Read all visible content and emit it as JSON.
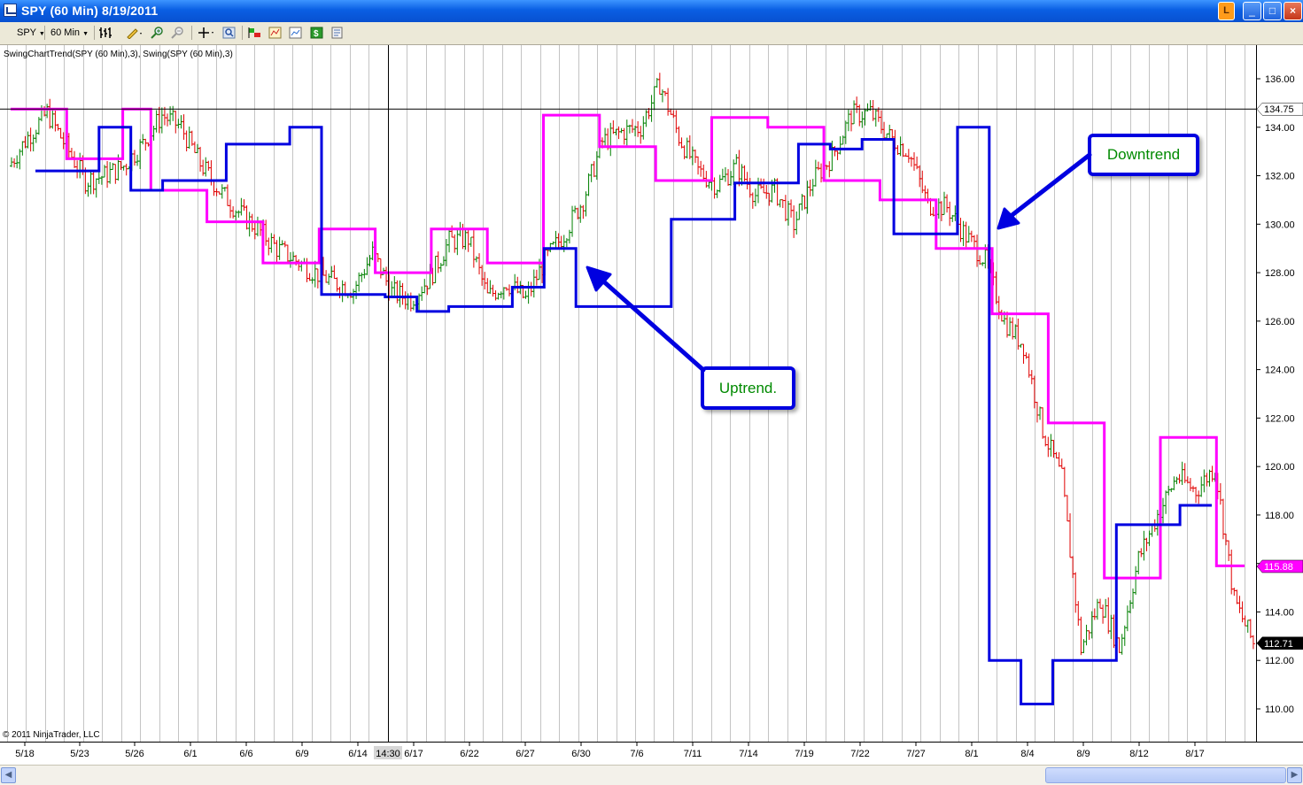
{
  "window": {
    "title": "SPY (60 Min)  8/19/2011",
    "buttons": [
      "L",
      "_",
      "□",
      "×"
    ]
  },
  "toolbar": {
    "instrument": "SPY",
    "interval": "60 Min",
    "icons": [
      "bar-type-icon",
      "drawing-pencil-icon",
      "zoom-in-icon",
      "zoom-out-icon",
      "crosshair-icon",
      "zoom-icon",
      "order-entry-icon",
      "strategies-icon",
      "chart-trader-icon",
      "dollar-icon",
      "properties-icon"
    ]
  },
  "chart": {
    "indicator_label": "SwingChartTrend(SPY (60 Min),3), Swing(SPY (60 Min),3)",
    "copyright": "© 2011 NinjaTrader, LLC",
    "price_ticks": [
      "136.00",
      "134.00",
      "132.00",
      "130.00",
      "128.00",
      "126.00",
      "124.00",
      "122.00",
      "120.00",
      "118.00",
      "116.00",
      "114.00",
      "112.00",
      "110.00"
    ],
    "date_ticks": [
      "5/18",
      "5/23",
      "5/26",
      "6/1",
      "6/6",
      "6/9",
      "6/14",
      "6/17",
      "6/22",
      "6/27",
      "6/30",
      "7/6",
      "7/11",
      "7/14",
      "7/19",
      "7/22",
      "7/27",
      "8/1",
      "8/4",
      "8/9",
      "8/12",
      "8/17"
    ],
    "crosshair_time": "14:30",
    "crosshair_price": "134.75",
    "magenta_price_label": "115.88",
    "last_price_label": "112.71",
    "colors": {
      "up_bar": "#008000",
      "down_bar": "#e00000",
      "downtrend_line": "#ff00ff",
      "uptrend_line": "#0000e0",
      "callout_border": "#0000e0",
      "callout_text": "#008a00"
    }
  },
  "annotations": {
    "downtrend": "Downtrend",
    "uptrend": "Uptrend."
  },
  "chart_data": {
    "type": "candlestick",
    "title": "SPY (60 Min)",
    "ylim": [
      109.0,
      137.0
    ],
    "x_tick_labels": [
      "5/18",
      "5/23",
      "5/26",
      "6/1",
      "6/6",
      "6/9",
      "6/14",
      "6/17",
      "6/22",
      "6/27",
      "6/30",
      "7/6",
      "7/11",
      "7/14",
      "7/19",
      "7/22",
      "7/27",
      "8/1",
      "8/4",
      "8/9",
      "8/12",
      "8/17"
    ],
    "price_path": [
      {
        "date": "5/18",
        "price": 132.4
      },
      {
        "date": "5/19",
        "price": 133.6
      },
      {
        "date": "5/20",
        "price": 134.6
      },
      {
        "date": "5/23",
        "price": 133.2
      },
      {
        "date": "5/24",
        "price": 131.8
      },
      {
        "date": "5/25",
        "price": 132.0
      },
      {
        "date": "5/26",
        "price": 132.4
      },
      {
        "date": "5/27",
        "price": 133.3
      },
      {
        "date": "5/31",
        "price": 134.5
      },
      {
        "date": "6/1",
        "price": 134.0
      },
      {
        "date": "6/2",
        "price": 132.5
      },
      {
        "date": "6/3",
        "price": 131.4
      },
      {
        "date": "6/6",
        "price": 130.5
      },
      {
        "date": "6/7",
        "price": 129.8
      },
      {
        "date": "6/8",
        "price": 129.0
      },
      {
        "date": "6/9",
        "price": 128.5
      },
      {
        "date": "6/10",
        "price": 128.0
      },
      {
        "date": "6/13",
        "price": 127.6
      },
      {
        "date": "6/14",
        "price": 127.3
      },
      {
        "date": "6/15",
        "price": 128.8
      },
      {
        "date": "6/16",
        "price": 127.2
      },
      {
        "date": "6/17",
        "price": 126.9
      },
      {
        "date": "6/20",
        "price": 127.8
      },
      {
        "date": "6/21",
        "price": 129.3
      },
      {
        "date": "6/22",
        "price": 129.4
      },
      {
        "date": "6/23",
        "price": 127.0
      },
      {
        "date": "6/24",
        "price": 127.6
      },
      {
        "date": "6/27",
        "price": 126.9
      },
      {
        "date": "6/28",
        "price": 128.5
      },
      {
        "date": "6/29",
        "price": 129.6
      },
      {
        "date": "6/30",
        "price": 131.0
      },
      {
        "date": "7/1",
        "price": 133.4
      },
      {
        "date": "7/5",
        "price": 133.8
      },
      {
        "date": "7/6",
        "price": 134.0
      },
      {
        "date": "7/7",
        "price": 135.8
      },
      {
        "date": "7/8",
        "price": 133.6
      },
      {
        "date": "7/11",
        "price": 132.2
      },
      {
        "date": "7/12",
        "price": 131.6
      },
      {
        "date": "7/13",
        "price": 132.4
      },
      {
        "date": "7/14",
        "price": 131.2
      },
      {
        "date": "7/15",
        "price": 131.4
      },
      {
        "date": "7/18",
        "price": 130.0
      },
      {
        "date": "7/19",
        "price": 131.8
      },
      {
        "date": "7/20",
        "price": 132.8
      },
      {
        "date": "7/21",
        "price": 134.5
      },
      {
        "date": "7/22",
        "price": 134.6
      },
      {
        "date": "7/25",
        "price": 133.6
      },
      {
        "date": "7/26",
        "price": 133.0
      },
      {
        "date": "7/27",
        "price": 130.8
      },
      {
        "date": "7/28",
        "price": 130.7
      },
      {
        "date": "7/29",
        "price": 129.5
      },
      {
        "date": "8/1",
        "price": 128.5
      },
      {
        "date": "8/2",
        "price": 126.0
      },
      {
        "date": "8/3",
        "price": 125.0
      },
      {
        "date": "8/4",
        "price": 121.5
      },
      {
        "date": "8/5",
        "price": 119.5
      },
      {
        "date": "8/8",
        "price": 112.5
      },
      {
        "date": "8/9",
        "price": 114.5
      },
      {
        "date": "8/10",
        "price": 112.5
      },
      {
        "date": "8/11",
        "price": 116.2
      },
      {
        "date": "8/12",
        "price": 118.0
      },
      {
        "date": "8/15",
        "price": 119.6
      },
      {
        "date": "8/16",
        "price": 119.0
      },
      {
        "date": "8/17",
        "price": 120.0
      },
      {
        "date": "8/18",
        "price": 114.5
      },
      {
        "date": "8/19",
        "price": 112.7
      }
    ],
    "series": [
      {
        "name": "SwingChartTrend down (magenta)",
        "values": [
          134.75,
          134.75,
          132.7,
          132.7,
          134.75,
          131.4,
          131.4,
          130.1,
          130.1,
          128.4,
          128.4,
          129.8,
          129.8,
          128.0,
          128.0,
          129.8,
          129.8,
          128.4,
          128.4,
          134.5,
          134.5,
          133.2,
          133.2,
          131.8,
          131.8,
          134.4,
          134.4,
          134.0,
          134.0,
          131.8,
          131.8,
          131.0,
          131.0,
          129.0,
          129.0,
          126.3,
          126.3,
          121.8,
          121.8,
          115.4,
          115.4,
          121.2,
          121.2,
          115.9
        ]
      },
      {
        "name": "SwingChartTrend up (blue)",
        "values": [
          132.2,
          132.2,
          134.0,
          131.4,
          131.8,
          131.8,
          133.3,
          133.3,
          134.0,
          127.1,
          127.1,
          127.0,
          126.4,
          126.6,
          126.6,
          127.4,
          129.0,
          126.6,
          126.6,
          126.6,
          130.2,
          130.2,
          131.7,
          131.7,
          133.3,
          133.1,
          133.5,
          129.6,
          129.6,
          134.0,
          112.0,
          110.2,
          112.0,
          112.0,
          117.6,
          117.6,
          118.4
        ]
      }
    ]
  }
}
